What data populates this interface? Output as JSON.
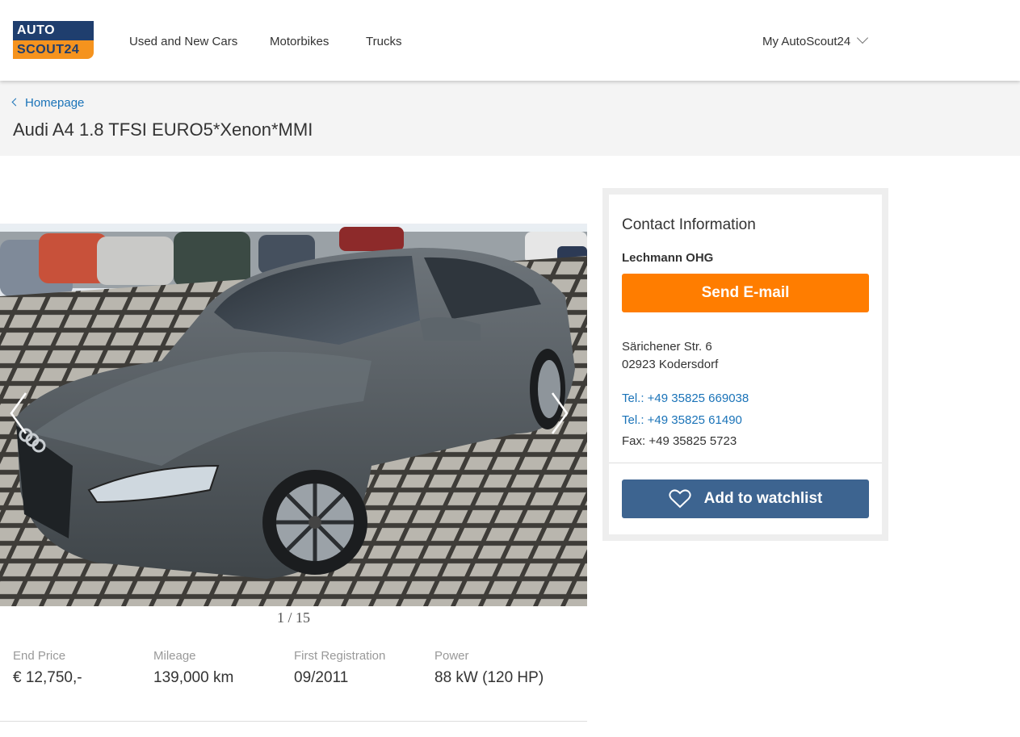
{
  "logo": {
    "line1": "AUTO",
    "line2": "SCOUT24"
  },
  "nav": {
    "items": [
      "Used and New Cars",
      "Motorbikes",
      "Trucks"
    ],
    "account_label": "My AutoScout24"
  },
  "breadcrumb": {
    "label": "Homepage"
  },
  "listing": {
    "title": "Audi A4 1.8 TFSI EURO5*Xenon*MMI",
    "gallery_counter": "1 / 15",
    "facts": [
      {
        "label": "End Price",
        "value": "€ 12,750,-"
      },
      {
        "label": "Mileage",
        "value": "139,000 km"
      },
      {
        "label": "First Registration",
        "value": "09/2011"
      },
      {
        "label": "Power",
        "value": "88 kW (120 HP)"
      }
    ]
  },
  "contact": {
    "title": "Contact Information",
    "dealer": "Lechmann OHG",
    "email_button": "Send E-mail",
    "address_line1": "Särichener Str. 6",
    "address_line2": "02923 Kodersdorf",
    "tel1": "Tel.: +49 35825 669038",
    "tel2": "Tel.: +49 35825 61490",
    "fax": "Fax: +49 35825 5723",
    "watchlist_button": "Add to watchlist"
  },
  "icons": {
    "heart": "heart-icon",
    "chevron_down": "chevron-down-icon",
    "chevron_left": "chevron-left-icon",
    "arrow_left": "arrow-left-icon",
    "arrow_right": "arrow-right-icon"
  },
  "colors": {
    "brand_blue": "#1f3e6e",
    "brand_orange": "#f5931e",
    "email_button": "#ff7d00",
    "watchlist_button": "#3d6490",
    "link": "#1a73b8"
  }
}
